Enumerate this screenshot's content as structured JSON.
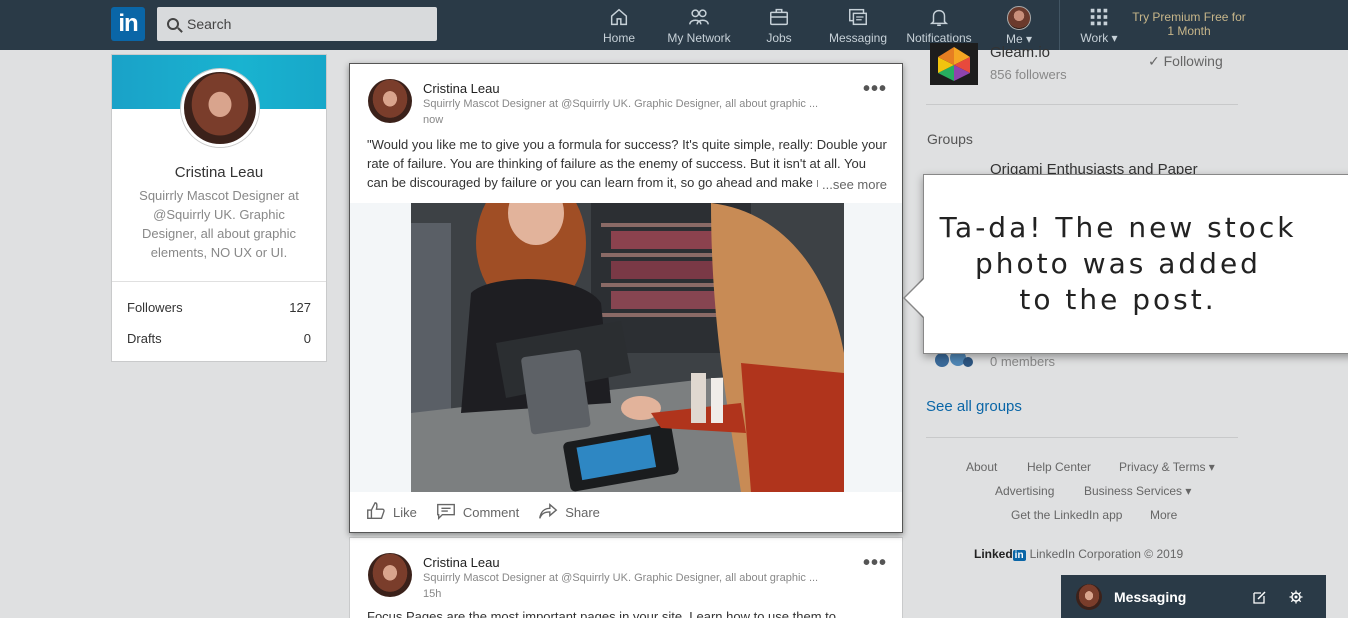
{
  "nav": {
    "logo": "in",
    "search_placeholder": "Search",
    "items": [
      {
        "label": "Home",
        "icon": "home-icon"
      },
      {
        "label": "My Network",
        "icon": "network-icon"
      },
      {
        "label": "Jobs",
        "icon": "briefcase-icon"
      },
      {
        "label": "Messaging",
        "icon": "messaging-icon"
      },
      {
        "label": "Notifications",
        "icon": "bell-icon"
      },
      {
        "label": "Me ▾",
        "icon": "avatar"
      },
      {
        "label": "Work ▾",
        "icon": "grid-icon"
      }
    ],
    "premium": "Try Premium Free for 1 Month"
  },
  "profile": {
    "name": "Cristina Leau",
    "headline": "Squirrly Mascot Designer at @Squirrly UK. Graphic Designer, all about graphic elements, NO UX or UI.",
    "stats": [
      {
        "label": "Followers",
        "value": "127"
      },
      {
        "label": "Drafts",
        "value": "0"
      }
    ]
  },
  "post": {
    "author": "Cristina Leau",
    "subline": "Squirrly Mascot Designer at @Squirrly UK. Graphic Designer, all about graphic ...",
    "time": "now",
    "text": "\"Would you like me to give you a formula for success? It's quite simple, really: Double your rate of failure. You are thinking of failure as the enemy of success. But it isn't at all. You can be discouraged by failure or you can learn from it, so go ahead and make mistakes.",
    "see_more": "...see more",
    "actions": {
      "like": "Like",
      "comment": "Comment",
      "share": "Share"
    }
  },
  "post2": {
    "author": "Cristina Leau",
    "subline": "Squirrly Mascot Designer at @Squirrly UK. Graphic Designer, all about graphic ...",
    "time": "15h",
    "text": "Focus Pages are the most important pages in your site. Learn how to use them to"
  },
  "right": {
    "company_name": "Gleam.io",
    "company_followers": "856 followers",
    "following": "✓ Following",
    "groups_title": "Groups",
    "group_name": "Origami Enthusiasts and Paper",
    "group_members": "0 members",
    "see_all": "See all groups",
    "footer": {
      "row1": [
        "About",
        "Help Center",
        "Privacy & Terms ▾"
      ],
      "row2": [
        "Advertising",
        "Business Services ▾"
      ],
      "row3": [
        "Get the LinkedIn app",
        "More"
      ],
      "brand_word": "Linked",
      "brand_in": "in",
      "corp": "LinkedIn Corporation © 2019"
    }
  },
  "callout": {
    "line1": "Ta-da! The new stock",
    "line2": "photo was added",
    "line3": "to the post."
  },
  "messaging": {
    "label": "Messaging"
  }
}
